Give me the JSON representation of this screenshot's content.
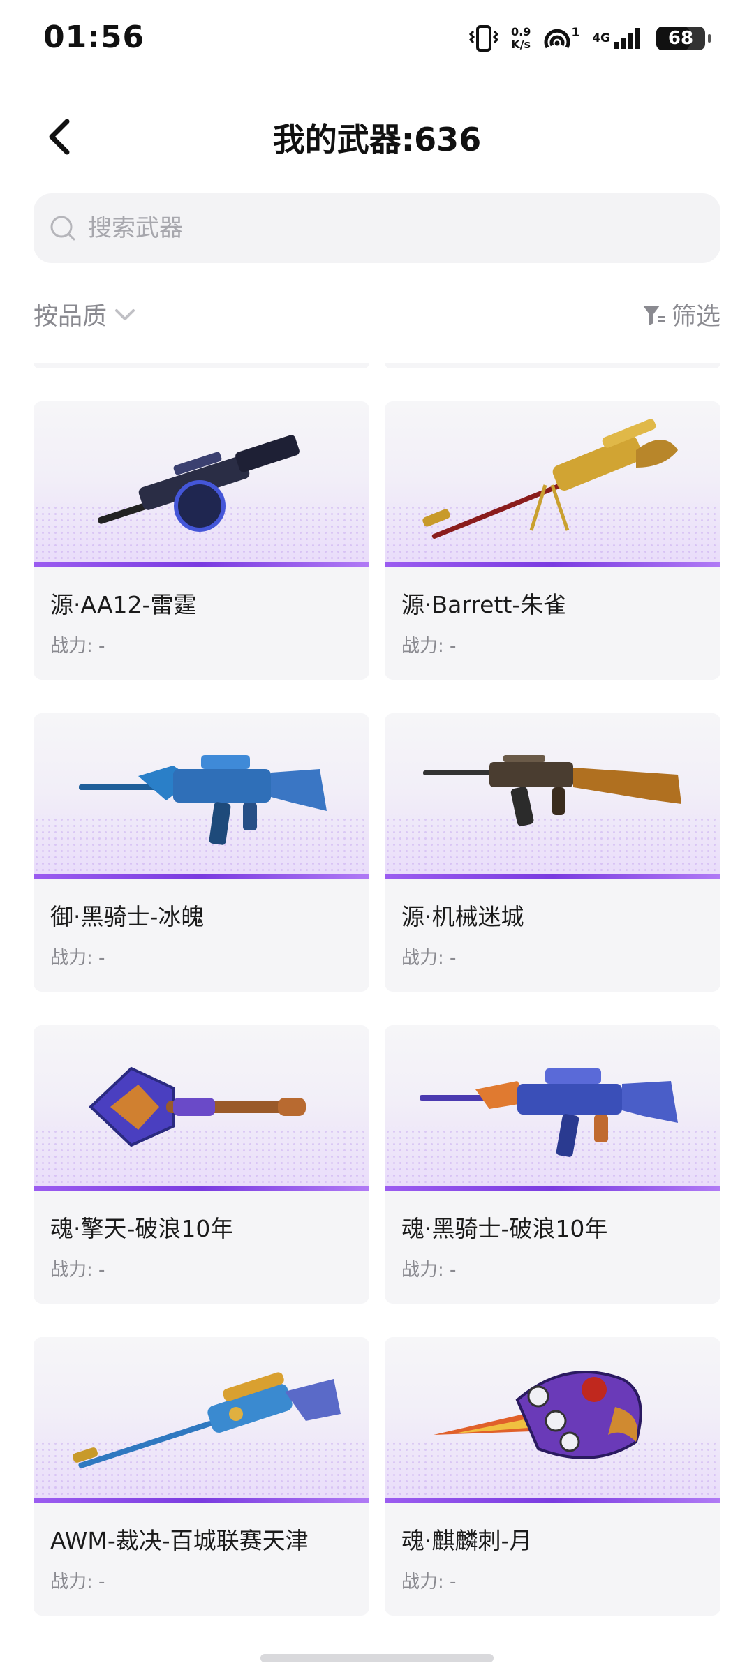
{
  "status_bar": {
    "time": "01:56",
    "speed_value": "0.9",
    "speed_unit": "K/s",
    "hotspot_count": "1",
    "network": "4G",
    "battery": "68"
  },
  "header": {
    "title": "我的武器:636"
  },
  "search": {
    "placeholder": "搜索武器",
    "value": ""
  },
  "sort": {
    "label": "按品质"
  },
  "filter": {
    "label": "筛选"
  },
  "weapons": [
    {
      "name": "源·AA12-雷霆",
      "power": "战力: -",
      "icon": "shotgun-icon",
      "color": "#2f3a8c"
    },
    {
      "name": "源·Barrett-朱雀",
      "power": "战力: -",
      "icon": "sniper-rifle-icon",
      "color": "#c8a030"
    },
    {
      "name": "御·黑骑士-冰魄",
      "power": "战力: -",
      "icon": "assault-rifle-icon",
      "color": "#2a7fc8"
    },
    {
      "name": "源·机械迷城",
      "power": "战力: -",
      "icon": "rifle-icon",
      "color": "#b07020"
    },
    {
      "name": "魂·擎天-破浪10年",
      "power": "战力: -",
      "icon": "shovel-icon",
      "color": "#5a3fc0"
    },
    {
      "name": "魂·黑骑士-破浪10年",
      "power": "战力: -",
      "icon": "assault-rifle-icon",
      "color": "#3a4fb8"
    },
    {
      "name": "AWM-裁决-百城联赛天津",
      "power": "战力: -",
      "icon": "sniper-rifle-icon",
      "color": "#2f78c0"
    },
    {
      "name": "魂·麒麟刺-月",
      "power": "战力: -",
      "icon": "knuckle-blade-icon",
      "color": "#6a3ab8"
    }
  ]
}
